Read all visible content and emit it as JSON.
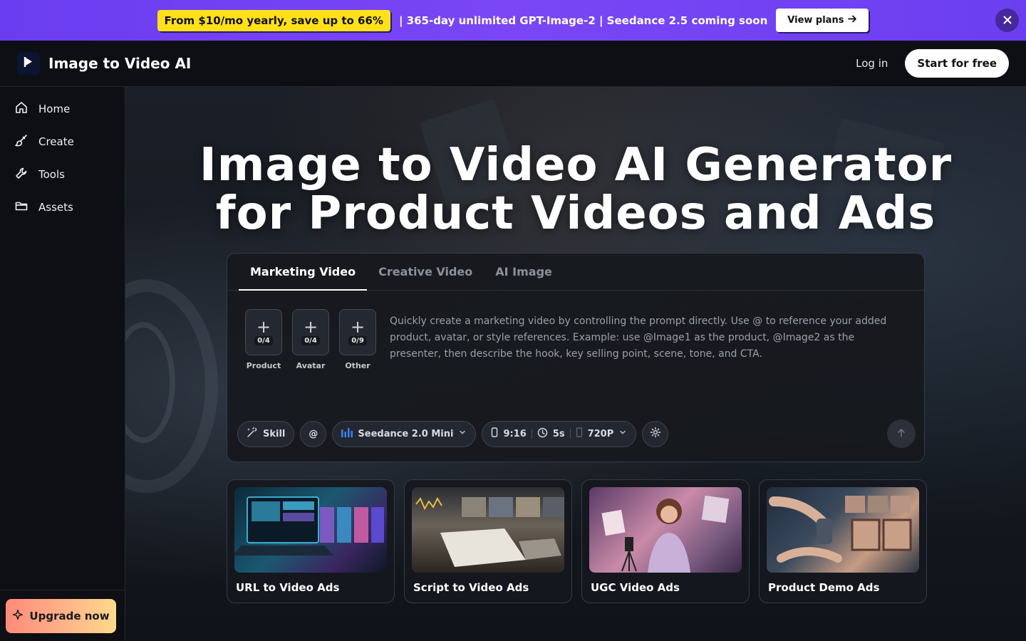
{
  "promo": {
    "highlight": "From $10/mo yearly, save up to 66%",
    "text": "| 365-day unlimited GPT-Image-2 | Seedance 2.5 coming soon",
    "button": "View plans"
  },
  "header": {
    "brand": "Image to Video AI",
    "login": "Log in",
    "cta": "Start for free"
  },
  "sidebar": {
    "items": [
      {
        "label": "Home",
        "icon": "home-icon"
      },
      {
        "label": "Create",
        "icon": "brush-icon"
      },
      {
        "label": "Tools",
        "icon": "wrench-icon"
      },
      {
        "label": "Assets",
        "icon": "folder-icon"
      }
    ],
    "upgrade": "Upgrade now"
  },
  "hero": {
    "title_line1": "Image to Video AI Generator",
    "title_line2": "for Product Videos and Ads"
  },
  "composer": {
    "tabs": [
      "Marketing Video",
      "Creative Video",
      "AI Image"
    ],
    "active_tab": "Marketing Video",
    "uploads": [
      {
        "label": "Product",
        "count": "0/4"
      },
      {
        "label": "Avatar",
        "count": "0/4"
      },
      {
        "label": "Other",
        "count": "0/9"
      }
    ],
    "placeholder": "Quickly create a marketing video by controlling the prompt directly. Use @ to reference your added product, avatar, or style references. Example: use @Image1 as the product, @Image2 as the presenter, then describe the hook, key selling point, scene, tone, and CTA.",
    "toolbar": {
      "skill": "Skill",
      "mention": "@",
      "model": "Seedance 2.0 Mini",
      "ratio": "9:16",
      "duration": "5s",
      "resolution": "720P"
    }
  },
  "templates": [
    {
      "label": "URL to Video Ads"
    },
    {
      "label": "Script to Video Ads"
    },
    {
      "label": "UGC Video Ads"
    },
    {
      "label": "Product Demo Ads"
    }
  ],
  "colors": {
    "promo_bg": "#6a3df0",
    "promo_highlight": "#ffe11a",
    "upgrade_gradient_start": "#ff8a7a",
    "upgrade_gradient_end": "#ffd98a",
    "model_icon": "#3b82f6"
  }
}
